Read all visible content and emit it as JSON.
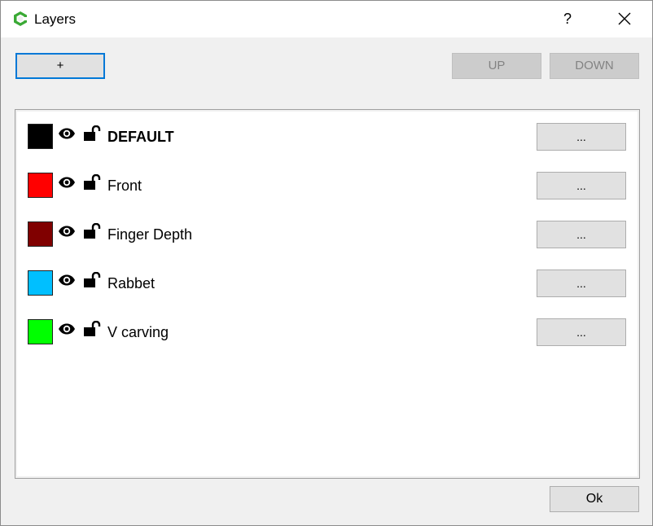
{
  "window": {
    "title": "Layers",
    "help_label": "?"
  },
  "toolbar": {
    "add_label": "+",
    "up_label": "UP",
    "down_label": "DOWN"
  },
  "layers": [
    {
      "name": "DEFAULT",
      "color": "#000000",
      "bold": true,
      "menu_label": "..."
    },
    {
      "name": "Front",
      "color": "#ff0000",
      "bold": false,
      "menu_label": "..."
    },
    {
      "name": "Finger Depth",
      "color": "#800000",
      "bold": false,
      "menu_label": "..."
    },
    {
      "name": "Rabbet",
      "color": "#00bfff",
      "bold": false,
      "menu_label": "..."
    },
    {
      "name": "V carving",
      "color": "#00ff00",
      "bold": false,
      "menu_label": "..."
    }
  ],
  "footer": {
    "ok_label": "Ok"
  },
  "icons": {
    "app": "app-logo-icon",
    "visibility": "eye-icon",
    "lock": "unlock-icon",
    "close": "close-icon"
  },
  "colors": {
    "accent": "#0078d7",
    "logo_green": "#3aa935"
  }
}
